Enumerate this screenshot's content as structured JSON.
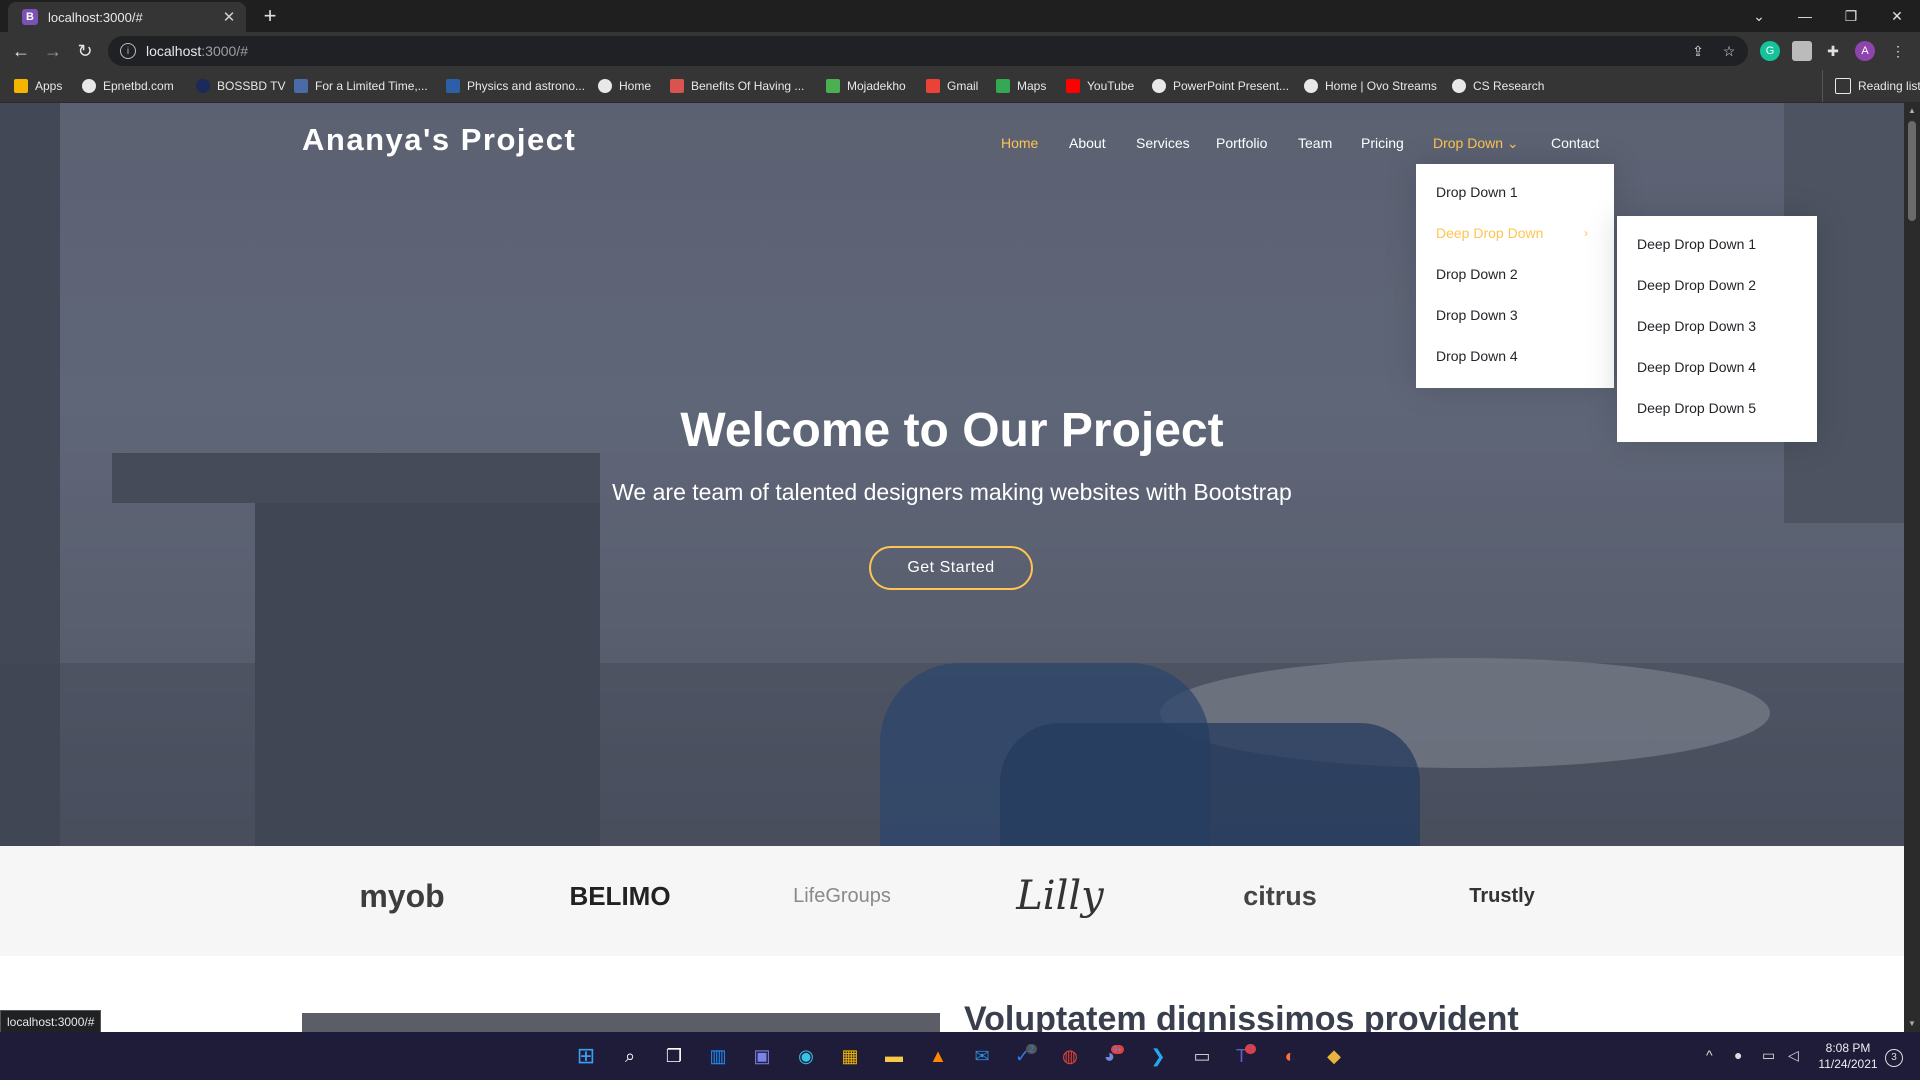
{
  "browser": {
    "tab_title": "localhost:3000/#",
    "tab_favicon": "B",
    "url_host": "localhost",
    "url_path": ":3000/#",
    "status_url": "localhost:3000/#",
    "reading_list": "Reading list",
    "profile_initial": "A"
  },
  "bookmarks": [
    {
      "label": "Apps",
      "icon": "apps-grid-icon"
    },
    {
      "label": "Epnetbd.com",
      "icon": "globe-icon"
    },
    {
      "label": "BOSSBD TV",
      "icon": "site-icon"
    },
    {
      "label": "For a Limited Time,...",
      "icon": "site-icon"
    },
    {
      "label": "Physics and astrono...",
      "icon": "site-icon"
    },
    {
      "label": "Home",
      "icon": "globe-icon"
    },
    {
      "label": "Benefits Of Having ...",
      "icon": "site-icon"
    },
    {
      "label": "Mojadekho",
      "icon": "site-icon"
    },
    {
      "label": "Gmail",
      "icon": "gmail-icon"
    },
    {
      "label": "Maps",
      "icon": "maps-icon"
    },
    {
      "label": "YouTube",
      "icon": "youtube-icon"
    },
    {
      "label": "PowerPoint Present...",
      "icon": "globe-icon"
    },
    {
      "label": "Home | Ovo Streams",
      "icon": "globe-icon"
    },
    {
      "label": "CS Research",
      "icon": "globe-icon"
    }
  ],
  "site": {
    "logo": "Ananya's Project",
    "nav": [
      "Home",
      "About",
      "Services",
      "Portfolio",
      "Team",
      "Pricing",
      "Drop Down",
      "Contact"
    ],
    "dropdown": [
      "Drop Down 1",
      "Deep Drop Down",
      "Drop Down 2",
      "Drop Down 3",
      "Drop Down 4"
    ],
    "deep_dropdown": [
      "Deep Drop Down 1",
      "Deep Drop Down 2",
      "Deep Drop Down 3",
      "Deep Drop Down 4",
      "Deep Drop Down 5"
    ],
    "hero_title": "Welcome to Our Project",
    "hero_subtitle": "We are team of talented designers making websites with Bootstrap",
    "cta": "Get Started",
    "clients": [
      "myob",
      "BELIMO",
      "LifeGroups",
      "Lilly",
      "citrus",
      "Trustly"
    ],
    "about_heading": "Voluptatem dignissimos provident"
  },
  "colors": {
    "accent": "#ffc451",
    "taskbar": "#1f1c3a",
    "chrome_dark": "#1f1f1f",
    "chrome": "#353535"
  },
  "taskbar": {
    "time": "8:08 PM",
    "date": "11/24/2021",
    "notifications": "3",
    "badges": {
      "todo": "2",
      "discord": "9+",
      "teams": "7"
    }
  }
}
